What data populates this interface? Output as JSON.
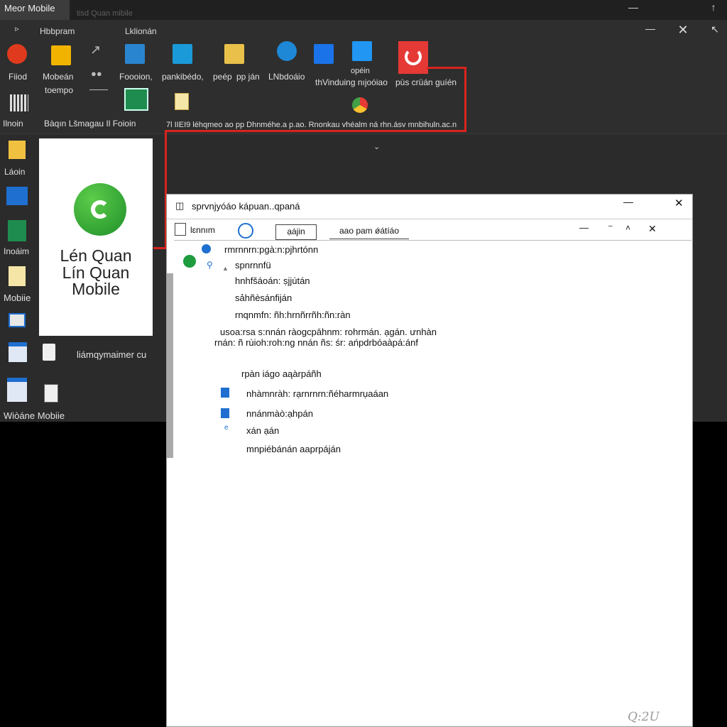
{
  "window": {
    "title": "Meor Mobile",
    "subtitle": "tisd Quan mibile"
  },
  "menu": {
    "items": [
      "Hbbpram",
      "Lklionán"
    ]
  },
  "ribbon": {
    "row1": [
      {
        "label": "Fiiod",
        "icon": "game-app-icon",
        "color": "#e03a1e"
      },
      {
        "label": "Mobeán",
        "label2": "toempo",
        "icon": "office-app-icon",
        "color": "#f2b300"
      },
      {
        "label": "Foooion,",
        "icon": "arrow-tool-icon",
        "color": "#2a85d0"
      },
      {
        "label": "pankibédo,",
        "icon": "screen-tool-icon",
        "color": "#1a9ad8"
      },
      {
        "label": "peép",
        "icon": "document-icon",
        "color": "#e8c04a"
      },
      {
        "label": "pp ján",
        "icon": "edge-icon",
        "color": "#1e88d6"
      },
      {
        "label": "LNbdoáio",
        "icon": "folder-blue-icon",
        "color": "#1a73e8"
      },
      {
        "label": "opéin",
        "label2": "thVinduing nıjoóiao",
        "icon": "image-viewer-icon",
        "color": "#2196f3"
      },
      {
        "label": "pùs crüán guíén",
        "icon": "red-spiral-icon",
        "color": "#e53935"
      }
    ],
    "row2": [
      {
        "label": "Ilnoin",
        "icon": "barcode-icon"
      },
      {
        "label": "Bàqın Lšmagau Il Foioin",
        "icon": "spreadsheet-icon"
      },
      {
        "label": "",
        "icon": "notepad-icon"
      },
      {
        "label": "",
        "icon": "chrome-icon"
      }
    ],
    "row2_text": "7l IIEI9 léhqmeo ao pp Dhnméhe.a p.ao. Rnonkau vhéalm ná rhn.ásv mnbihuln.ac.n"
  },
  "desktop": {
    "items": [
      {
        "label": "Láoin",
        "icon": "folder-icon"
      },
      {
        "label": "",
        "icon": "store-icon"
      },
      {
        "label": "Inoáim",
        "icon": "spreadsheet-icon"
      },
      {
        "label": "Mobiie",
        "icon": "notepad-icon"
      },
      {
        "label": "",
        "icon": "monitor-icon"
      },
      {
        "label": "",
        "icon": "window-icon"
      },
      {
        "label": "Wiòáne Mobiie",
        "icon": "calculator-icon"
      }
    ],
    "side_text": "liámqymaimer cu",
    "small_icons": [
      "bag-icon",
      "phone-icon"
    ]
  },
  "promo": {
    "line1": "Lén Quan",
    "line2": "Lín Quan",
    "line3": "Mobile"
  },
  "dialog": {
    "title": "sprvnjyóáo kápuan..qpaná",
    "toolbar": {
      "field1": "lɛnnım",
      "button1": "ạájin",
      "button2": "aao pam ǿátíáo"
    },
    "tree": [
      {
        "text": "rmrnnrn:pgà:n:pjhrtónn",
        "indent": 0,
        "icon": "globe-icon"
      },
      {
        "text": "spnrnnfü",
        "indent": 1,
        "icon": "search-icon"
      },
      {
        "text": "hnhfšáoán: ṣjjútán",
        "indent": 2,
        "icon": ""
      },
      {
        "text": "sảhñèsánfiján",
        "indent": 2,
        "icon": ""
      },
      {
        "text": "rnqnmfn: ñh:hrnñrrñh:ñn:ràn",
        "indent": 2,
        "icon": ""
      },
      {
        "text": "usoa:rsa s:nnán ràogcpāhnm: rohrmán. ạgán. ưnhàn",
        "indent": 3,
        "icon": ""
      },
      {
        "text": "rnán: ñ rùioh:roh:ng nnán ñs: śr: ańpdrbóaàpá:ánf",
        "indent": 3,
        "icon": ""
      },
      {
        "text": "rpàn iágo aąàrpáñh",
        "indent": 4,
        "icon": ""
      },
      {
        "text": "nhàmnràh: rạrnrnrn:ñéharmrụaáan",
        "indent": 5,
        "icon": "file-icon"
      },
      {
        "text": "nnánmàò:ạhpán",
        "indent": 5,
        "icon": "file-icon"
      },
      {
        "text": "xán ạán",
        "indent": 5,
        "icon": "small-e-icon"
      },
      {
        "text": "mnpiébánán aaprpáján",
        "indent": 5,
        "icon": ""
      }
    ],
    "watermark": "Q:2U"
  }
}
